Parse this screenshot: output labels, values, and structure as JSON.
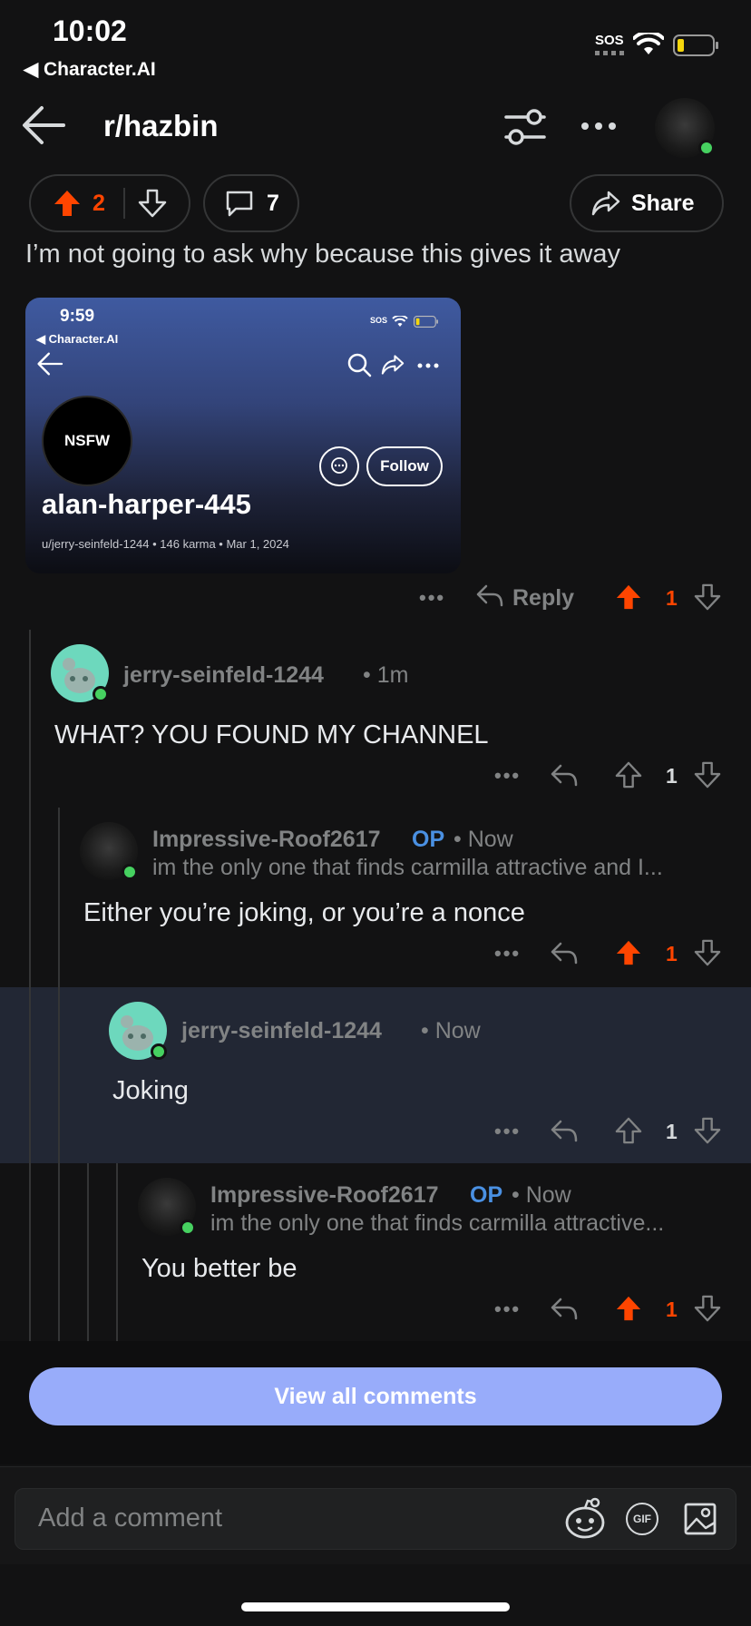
{
  "status_bar": {
    "time": "10:02",
    "back_app": "◀ Character.AI",
    "sos": "SOS"
  },
  "header": {
    "subreddit": "r/hazbin"
  },
  "actions": {
    "upvotes": "2",
    "comments": "7",
    "share_label": "Share"
  },
  "post": {
    "body": "I’m not going to ask why because this gives it away"
  },
  "embedded_screenshot": {
    "time": "9:59",
    "back_app": "◀ Character.AI",
    "sos": "SOS",
    "avatar_label": "NSFW",
    "follow_label": "Follow",
    "username": "alan-harper-445",
    "meta": "u/jerry-seinfeld-1244 • 146 karma • Mar 1, 2024"
  },
  "post_actions": {
    "reply_label": "Reply",
    "score": "1"
  },
  "comments": [
    {
      "user": "jerry-seinfeld-1244",
      "time": "• 1m",
      "text": "WHAT? YOU FOUND MY CHANNEL",
      "score": "1",
      "upvoted": false
    },
    {
      "user": "Impressive-Roof2617",
      "op": "OP",
      "time": "• Now",
      "quote": "im the only one that finds carmilla attractive and I...",
      "text": "Either you’re joking, or you’re a nonce",
      "score": "1",
      "upvoted": true
    },
    {
      "user": "jerry-seinfeld-1244",
      "time": "• Now",
      "text": "Joking",
      "score": "1",
      "upvoted": false
    },
    {
      "user": "Impressive-Roof2617",
      "op": "OP",
      "time": "• Now",
      "quote": "im the only one that finds carmilla attractive...",
      "text": "You better be",
      "score": "1",
      "upvoted": true
    }
  ],
  "view_all_label": "View all comments",
  "composer": {
    "placeholder": "Add a comment",
    "gif_label": "GIF"
  },
  "colors": {
    "upvote": "#ff4500",
    "op": "#4a90e2",
    "online": "#46d160",
    "view_all": "#98acfa",
    "highlight": "#222734"
  }
}
